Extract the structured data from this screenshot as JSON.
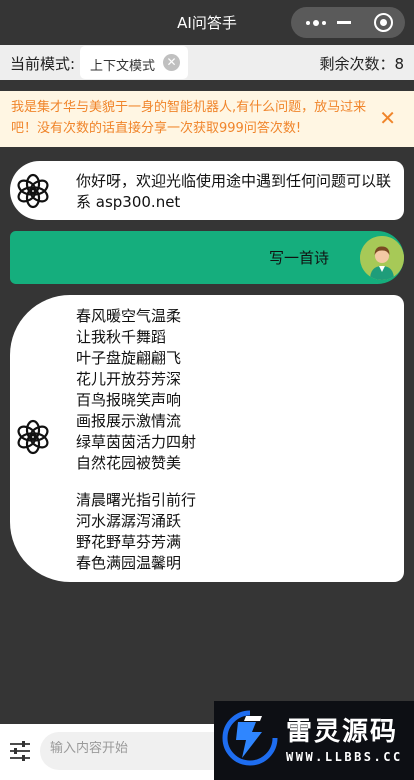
{
  "nav": {
    "title": "AI问答手"
  },
  "mode": {
    "label": "当前模式:",
    "chip": "上下文模式",
    "chip_close": "✕",
    "remaining": "剩余次数：8"
  },
  "notice": {
    "text": "我是集才华与美貌于一身的智能机器人,有什么问题，放马过来吧！没有次数的话直接分享一次获取999问答次数!",
    "close": "✕"
  },
  "chat": {
    "welcome": "你好呀，欢迎光临使用途中遇到任何问题可以联系  asp300.net",
    "user_message": "写一首诗",
    "poem_stanza1": [
      "春风暖空气温柔",
      "让我秋千舞蹈",
      "叶子盘旋翩翩飞",
      "花儿开放芬芳深",
      "百鸟报晓笑声响",
      "画报展示激情流",
      "绿草茵茵活力四射",
      "自然花园被赞美"
    ],
    "poem_stanza2": [
      "清晨曙光指引前行",
      "河水潺潺泻涌跃",
      "野花野草芬芳满",
      "春色满园温馨明"
    ]
  },
  "input": {
    "placeholder": "输入内容开始"
  },
  "watermark": {
    "title": "雷灵源码",
    "url": "WWW.LLBBS.CC"
  },
  "colors": {
    "accent": "#15ae7d",
    "notice_text": "#f0852b",
    "notice_bg": "#fff6e3",
    "background": "#353535"
  },
  "icons": {
    "ai": "openai-logo-icon",
    "user": "user-avatar-icon",
    "settings": "sliders-icon",
    "more": "more-dots-icon"
  }
}
